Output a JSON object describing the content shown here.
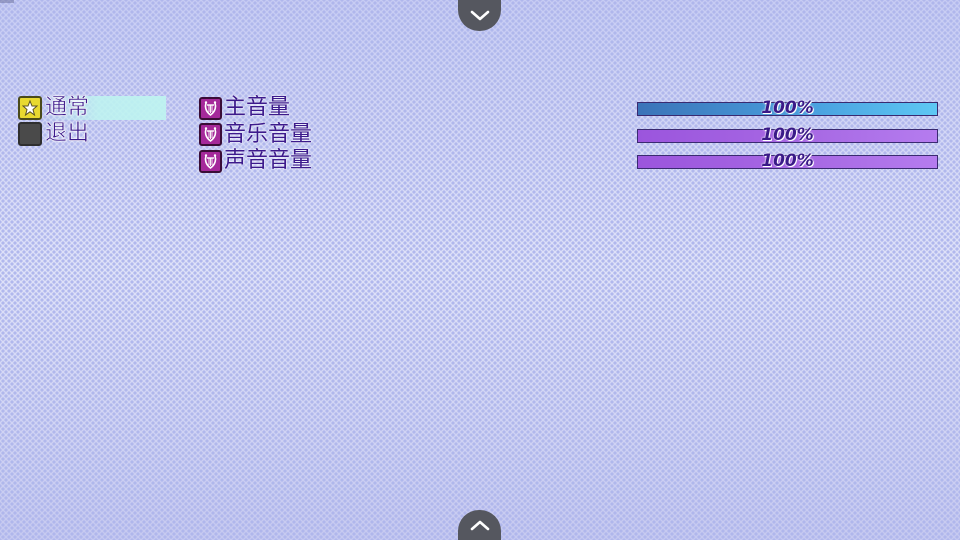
{
  "nav": {
    "scroll_up_icon": "chevron-down-icon",
    "scroll_down_icon": "chevron-up-icon"
  },
  "commands": {
    "items": [
      {
        "label": "通常",
        "icon": "star-icon",
        "selected": true
      },
      {
        "label": "退出",
        "icon": "exit-icon",
        "selected": false
      }
    ]
  },
  "options": {
    "rows": [
      {
        "label": "主音量",
        "icon": "lyre-icon",
        "value": 1.0,
        "value_text": "100%",
        "style": "master"
      },
      {
        "label": "音乐音量",
        "icon": "lyre-icon",
        "value": 1.0,
        "value_text": "100%",
        "style": "other"
      },
      {
        "label": "声音音量",
        "icon": "lyre-icon",
        "value": 1.0,
        "value_text": "100%",
        "style": "other"
      }
    ]
  },
  "colors": {
    "text": "#3c1a8c",
    "master_gauge": "#4aa2e0",
    "other_gauge": "#a86ae4",
    "icon_purple": "#a5299a",
    "star_yellow": "#e8d930"
  }
}
